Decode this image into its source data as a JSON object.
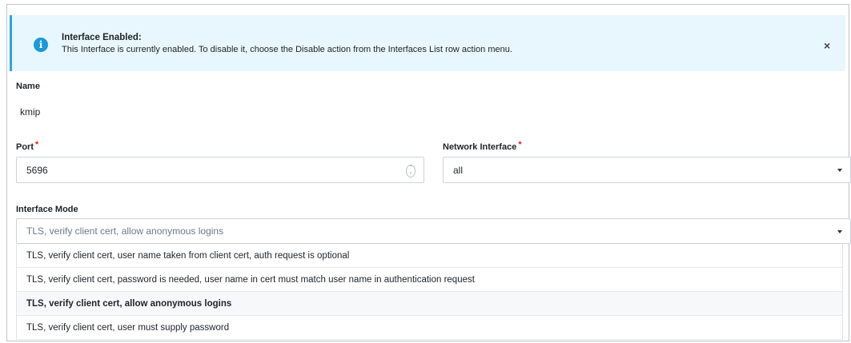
{
  "alert": {
    "title": "Interface Enabled:",
    "message": "This Interface is currently enabled. To disable it, choose the Disable action from the Interfaces List row action menu.",
    "close_glyph": "×",
    "icon": "info-icon"
  },
  "form": {
    "name_label": "Name",
    "name_value": "kmip",
    "port_label": "Port",
    "port_value": "5696",
    "required_mark": "*",
    "network_label": "Network Interface",
    "network_value": "all",
    "mode_label": "Interface Mode",
    "mode_value": "TLS, verify client cert, allow anonymous logins"
  },
  "mode_options": [
    "TLS, verify client cert, user name taken from client cert, auth request is optional",
    "TLS, verify client cert, password is needed, user name in cert must match user name in authentication request",
    "TLS, verify client cert, allow anonymous logins",
    "TLS, verify client cert, user must supply password"
  ],
  "selected_option_index": 2,
  "colors": {
    "accent": "#2aa6df",
    "alert_bg": "#e8f6fd",
    "required": "#d9262c"
  }
}
